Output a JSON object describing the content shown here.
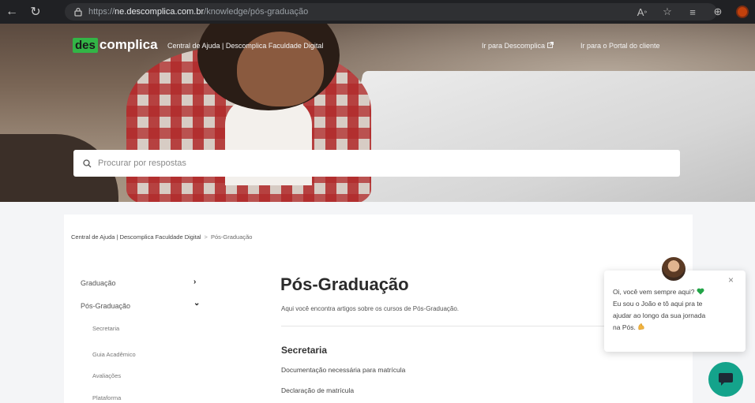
{
  "browser": {
    "url_scheme": "https://",
    "url_host": "ne.descomplica.com.br",
    "url_path": "/knowledge/pós-graduação"
  },
  "hero": {
    "logo_part1": "des",
    "logo_part2": "complica",
    "site_name": "Central de Ajuda | Descomplica Faculdade Digital",
    "link_descomplica": "Ir para Descomplica",
    "link_portal": "Ir para o Portal do cliente",
    "search_placeholder": "Procurar por respostas"
  },
  "breadcrumb": {
    "root": "Central de Ajuda | Descomplica Faculdade Digital",
    "separator": ">",
    "current": "Pós-Graduação"
  },
  "sidebar": {
    "items": [
      {
        "label": "Graduação",
        "chevron": "›"
      },
      {
        "label": "Pós-Graduação",
        "chevron": "⌄"
      }
    ],
    "subitems": [
      "Secretaria",
      "Guia Acadêmico",
      "Avaliações",
      "Plataforma"
    ]
  },
  "main": {
    "title": "Pós-Graduação",
    "description": "Aqui você encontra artigos sobre os cursos de Pós-Graduação.",
    "section_title": "Secretaria",
    "articles": [
      "Documentação necessária para matrícula",
      "Declaração de matrícula"
    ]
  },
  "chat": {
    "line1": "Oi, você vem sempre aqui?",
    "line2": "Eu sou o João e tô aqui pra te",
    "line3": "ajudar ao longo da sua jornada",
    "line4": "na Pós.",
    "close_symbol": "×"
  },
  "colors": {
    "brand_green": "#32b546",
    "chat_teal": "#14a38b",
    "heart_green": "#22a447"
  }
}
